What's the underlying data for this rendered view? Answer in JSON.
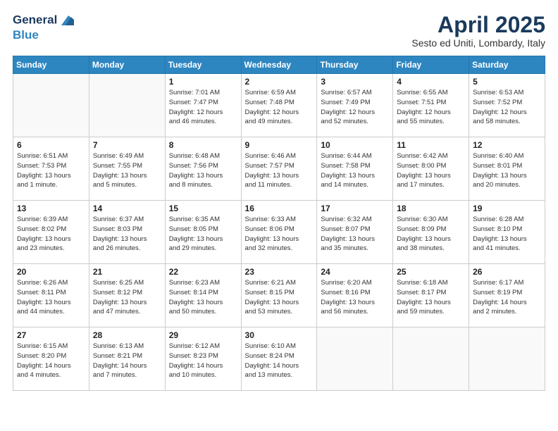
{
  "logo": {
    "line1": "General",
    "line2": "Blue"
  },
  "title": "April 2025",
  "subtitle": "Sesto ed Uniti, Lombardy, Italy",
  "days_header": [
    "Sunday",
    "Monday",
    "Tuesday",
    "Wednesday",
    "Thursday",
    "Friday",
    "Saturday"
  ],
  "weeks": [
    [
      {
        "num": "",
        "detail": ""
      },
      {
        "num": "",
        "detail": ""
      },
      {
        "num": "1",
        "detail": "Sunrise: 7:01 AM\nSunset: 7:47 PM\nDaylight: 12 hours\nand 46 minutes."
      },
      {
        "num": "2",
        "detail": "Sunrise: 6:59 AM\nSunset: 7:48 PM\nDaylight: 12 hours\nand 49 minutes."
      },
      {
        "num": "3",
        "detail": "Sunrise: 6:57 AM\nSunset: 7:49 PM\nDaylight: 12 hours\nand 52 minutes."
      },
      {
        "num": "4",
        "detail": "Sunrise: 6:55 AM\nSunset: 7:51 PM\nDaylight: 12 hours\nand 55 minutes."
      },
      {
        "num": "5",
        "detail": "Sunrise: 6:53 AM\nSunset: 7:52 PM\nDaylight: 12 hours\nand 58 minutes."
      }
    ],
    [
      {
        "num": "6",
        "detail": "Sunrise: 6:51 AM\nSunset: 7:53 PM\nDaylight: 13 hours\nand 1 minute."
      },
      {
        "num": "7",
        "detail": "Sunrise: 6:49 AM\nSunset: 7:55 PM\nDaylight: 13 hours\nand 5 minutes."
      },
      {
        "num": "8",
        "detail": "Sunrise: 6:48 AM\nSunset: 7:56 PM\nDaylight: 13 hours\nand 8 minutes."
      },
      {
        "num": "9",
        "detail": "Sunrise: 6:46 AM\nSunset: 7:57 PM\nDaylight: 13 hours\nand 11 minutes."
      },
      {
        "num": "10",
        "detail": "Sunrise: 6:44 AM\nSunset: 7:58 PM\nDaylight: 13 hours\nand 14 minutes."
      },
      {
        "num": "11",
        "detail": "Sunrise: 6:42 AM\nSunset: 8:00 PM\nDaylight: 13 hours\nand 17 minutes."
      },
      {
        "num": "12",
        "detail": "Sunrise: 6:40 AM\nSunset: 8:01 PM\nDaylight: 13 hours\nand 20 minutes."
      }
    ],
    [
      {
        "num": "13",
        "detail": "Sunrise: 6:39 AM\nSunset: 8:02 PM\nDaylight: 13 hours\nand 23 minutes."
      },
      {
        "num": "14",
        "detail": "Sunrise: 6:37 AM\nSunset: 8:03 PM\nDaylight: 13 hours\nand 26 minutes."
      },
      {
        "num": "15",
        "detail": "Sunrise: 6:35 AM\nSunset: 8:05 PM\nDaylight: 13 hours\nand 29 minutes."
      },
      {
        "num": "16",
        "detail": "Sunrise: 6:33 AM\nSunset: 8:06 PM\nDaylight: 13 hours\nand 32 minutes."
      },
      {
        "num": "17",
        "detail": "Sunrise: 6:32 AM\nSunset: 8:07 PM\nDaylight: 13 hours\nand 35 minutes."
      },
      {
        "num": "18",
        "detail": "Sunrise: 6:30 AM\nSunset: 8:09 PM\nDaylight: 13 hours\nand 38 minutes."
      },
      {
        "num": "19",
        "detail": "Sunrise: 6:28 AM\nSunset: 8:10 PM\nDaylight: 13 hours\nand 41 minutes."
      }
    ],
    [
      {
        "num": "20",
        "detail": "Sunrise: 6:26 AM\nSunset: 8:11 PM\nDaylight: 13 hours\nand 44 minutes."
      },
      {
        "num": "21",
        "detail": "Sunrise: 6:25 AM\nSunset: 8:12 PM\nDaylight: 13 hours\nand 47 minutes."
      },
      {
        "num": "22",
        "detail": "Sunrise: 6:23 AM\nSunset: 8:14 PM\nDaylight: 13 hours\nand 50 minutes."
      },
      {
        "num": "23",
        "detail": "Sunrise: 6:21 AM\nSunset: 8:15 PM\nDaylight: 13 hours\nand 53 minutes."
      },
      {
        "num": "24",
        "detail": "Sunrise: 6:20 AM\nSunset: 8:16 PM\nDaylight: 13 hours\nand 56 minutes."
      },
      {
        "num": "25",
        "detail": "Sunrise: 6:18 AM\nSunset: 8:17 PM\nDaylight: 13 hours\nand 59 minutes."
      },
      {
        "num": "26",
        "detail": "Sunrise: 6:17 AM\nSunset: 8:19 PM\nDaylight: 14 hours\nand 2 minutes."
      }
    ],
    [
      {
        "num": "27",
        "detail": "Sunrise: 6:15 AM\nSunset: 8:20 PM\nDaylight: 14 hours\nand 4 minutes."
      },
      {
        "num": "28",
        "detail": "Sunrise: 6:13 AM\nSunset: 8:21 PM\nDaylight: 14 hours\nand 7 minutes."
      },
      {
        "num": "29",
        "detail": "Sunrise: 6:12 AM\nSunset: 8:23 PM\nDaylight: 14 hours\nand 10 minutes."
      },
      {
        "num": "30",
        "detail": "Sunrise: 6:10 AM\nSunset: 8:24 PM\nDaylight: 14 hours\nand 13 minutes."
      },
      {
        "num": "",
        "detail": ""
      },
      {
        "num": "",
        "detail": ""
      },
      {
        "num": "",
        "detail": ""
      }
    ]
  ]
}
